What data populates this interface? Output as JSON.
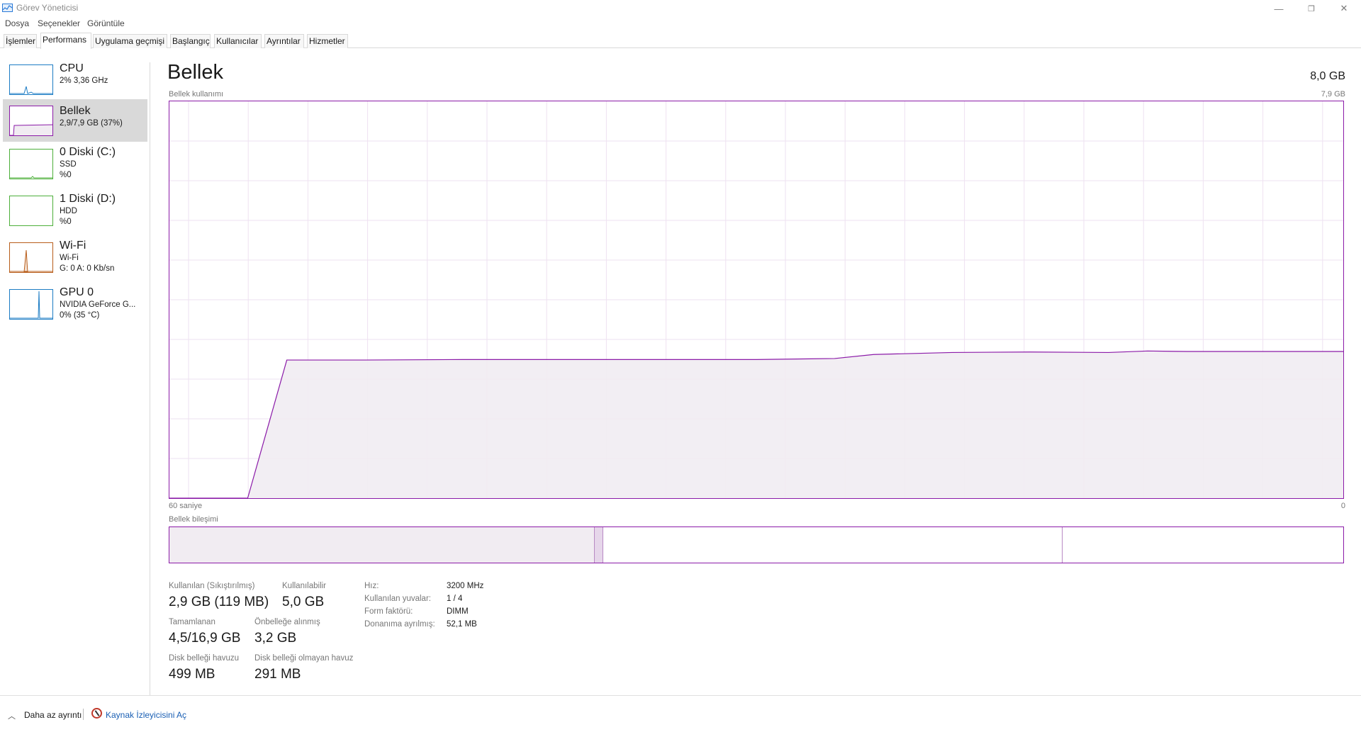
{
  "window": {
    "title": "Görev Yöneticisi",
    "controls": {
      "minimize": "—",
      "restore": "❐",
      "close": "✕"
    }
  },
  "menu": [
    "Dosya",
    "Seçenekler",
    "Görüntüle"
  ],
  "tabs": [
    {
      "label": "İşlemler",
      "active": false
    },
    {
      "label": "Performans",
      "active": true
    },
    {
      "label": "Uygulama geçmişi",
      "active": false
    },
    {
      "label": "Başlangıç",
      "active": false
    },
    {
      "label": "Kullanıcılar",
      "active": false
    },
    {
      "label": "Ayrıntılar",
      "active": false
    },
    {
      "label": "Hizmetler",
      "active": false
    }
  ],
  "sidebar": [
    {
      "title": "CPU",
      "line1": "2%  3,36 GHz",
      "line2": "",
      "color": "#1c7cc4",
      "selected": false
    },
    {
      "title": "Bellek",
      "line1": "2,9/7,9 GB (37%)",
      "line2": "",
      "color": "#8b1aa8",
      "selected": true
    },
    {
      "title": "0 Diski (C:)",
      "line1": "SSD",
      "line2": "%0",
      "color": "#4caf3a",
      "selected": false
    },
    {
      "title": "1 Diski (D:)",
      "line1": "HDD",
      "line2": "%0",
      "color": "#4caf3a",
      "selected": false
    },
    {
      "title": "Wi-Fi",
      "line1": "Wi-Fi",
      "line2": "G: 0  A: 0 Kb/sn",
      "color": "#b85d1a",
      "selected": false
    },
    {
      "title": "GPU 0",
      "line1": "NVIDIA GeForce G...",
      "line2": "0% (35 °C)",
      "color": "#1c7cc4",
      "selected": false
    }
  ],
  "main": {
    "title": "Bellek",
    "capacity": "8,0 GB",
    "usage_label": "Bellek kullanımı",
    "usage_max": "7,9 GB",
    "time_left": "60 saniye",
    "time_right": "0",
    "composition_label": "Bellek bileşimi"
  },
  "chart_data": {
    "type": "area",
    "title": "Bellek kullanımı",
    "xlabel": "60 saniye",
    "ylabel": "",
    "x_direction": "seconds ago, 60 to 0",
    "ylim": [
      0,
      7.9
    ],
    "y_unit": "GB",
    "color": "#8b1aa8",
    "grid": true,
    "x": [
      60,
      56,
      54,
      50,
      45,
      40,
      36,
      30,
      26,
      24,
      20,
      16,
      12,
      10,
      8,
      0
    ],
    "values": [
      0,
      0,
      2.75,
      2.75,
      2.76,
      2.76,
      2.76,
      2.76,
      2.78,
      2.86,
      2.9,
      2.91,
      2.9,
      2.93,
      2.92,
      2.92
    ]
  },
  "composition": {
    "in_use_fraction": 0.362,
    "modified_fraction": 0.007,
    "standby_fraction": 0.391,
    "free_fraction": 0.24
  },
  "stats": {
    "in_use_label": "Kullanılan (Sıkıştırılmış)",
    "in_use_value": "2,9 GB (119 MB)",
    "available_label": "Kullanılabilir",
    "available_value": "5,0 GB",
    "committed_label": "Tamamlanan",
    "committed_value": "4,5/16,9 GB",
    "cached_label": "Önbelleğe alınmış",
    "cached_value": "3,2 GB",
    "paged_label": "Disk belleği havuzu",
    "paged_value": "499 MB",
    "nonpaged_label": "Disk belleği olmayan havuz",
    "nonpaged_value": "291 MB"
  },
  "specs": {
    "speed_label": "Hız:",
    "speed_value": "3200 MHz",
    "slots_label": "Kullanılan yuvalar:",
    "slots_value": "1 / 4",
    "form_label": "Form faktörü:",
    "form_value": "DIMM",
    "reserved_label": "Donanıma ayrılmış:",
    "reserved_value": "52,1 MB"
  },
  "footer": {
    "fewer_details": "Daha az ayrıntı",
    "resource_monitor": "Kaynak İzleyicisini Aç"
  }
}
